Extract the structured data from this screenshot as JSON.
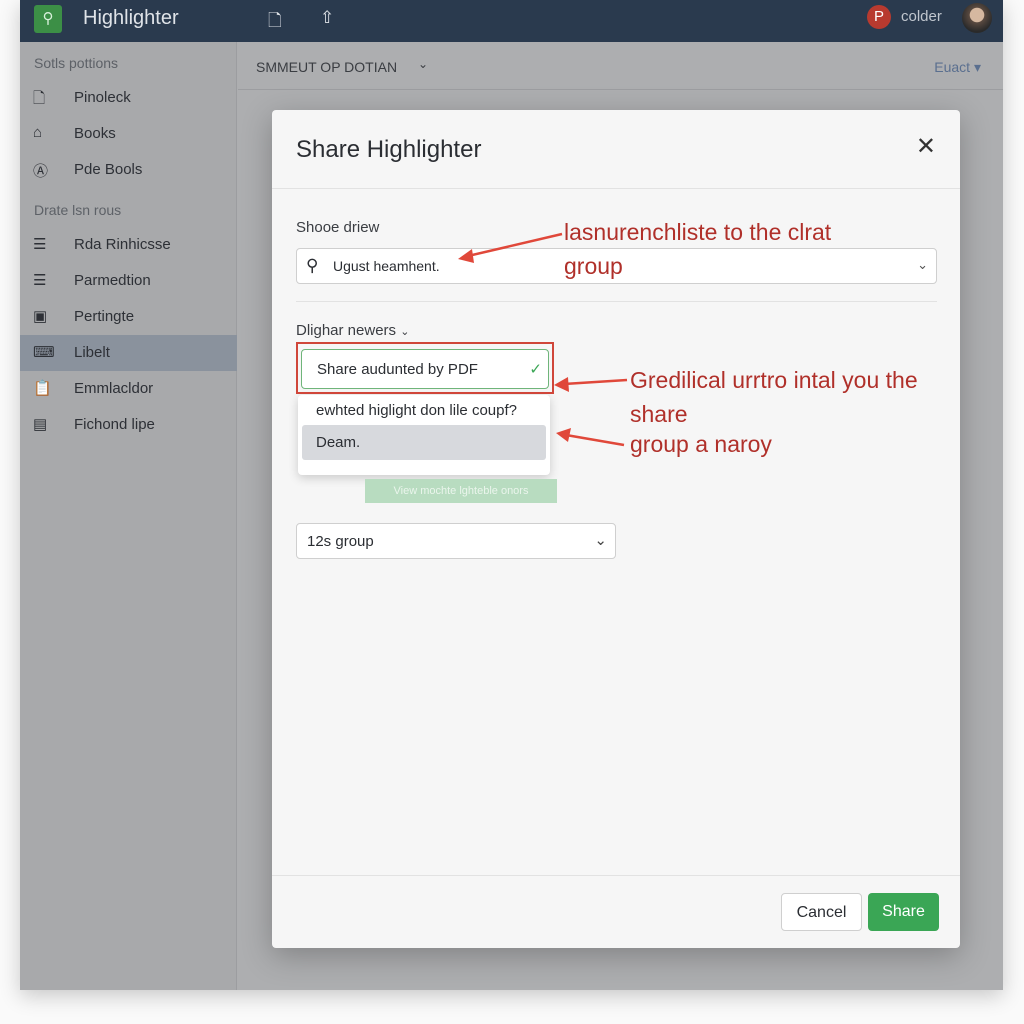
{
  "app": {
    "title": "Highlighter",
    "user": "colder",
    "user_initial": "P"
  },
  "topbar": {
    "icons": [
      "document-icon",
      "upload-icon"
    ]
  },
  "sidebar": {
    "section1": "Sotls pottions",
    "items1": [
      {
        "label": "Pinoleck",
        "icon": "document-icon"
      },
      {
        "label": "Books",
        "icon": "cloud-icon"
      },
      {
        "label": "Pde Bools",
        "icon": "badge-icon"
      }
    ],
    "section2": "Drate lsn rous",
    "items2": [
      {
        "label": "Rda Rinhicsse",
        "icon": "list-icon"
      },
      {
        "label": "Parmedtion",
        "icon": "list-icon"
      },
      {
        "label": "Pertingte",
        "icon": "image-icon"
      },
      {
        "label": "Libelt",
        "icon": "keyboard-icon",
        "selected": true
      },
      {
        "label": "Emmlacldor",
        "icon": "clipboard-icon"
      },
      {
        "label": "Fichond lipe",
        "icon": "file-icon"
      }
    ]
  },
  "main": {
    "breadcrumb": "SMMEUT OP DOTIAN",
    "export": "Euact"
  },
  "modal": {
    "title": "Share Highlighter",
    "search_label": "Shooe driew",
    "search_value": "Ugust heamhent.",
    "annotation1": "lasnurenchliste to the clrat group",
    "dropdown_label": "Dlighar newers",
    "selected_option": "Share audunted by PDF",
    "options": [
      "ewhted higlight don lile coupf?",
      "Deam."
    ],
    "annotation2": "Gredilical urrtro intal you the share",
    "annotation3": "group a naroy",
    "hint_button": "View mochte lghteble onors",
    "group_select": "12s group",
    "cancel": "Cancel",
    "share": "Share"
  },
  "colors": {
    "accent": "#3aa655",
    "annotation": "#b0302a",
    "topbar": "#2a3a4e"
  }
}
